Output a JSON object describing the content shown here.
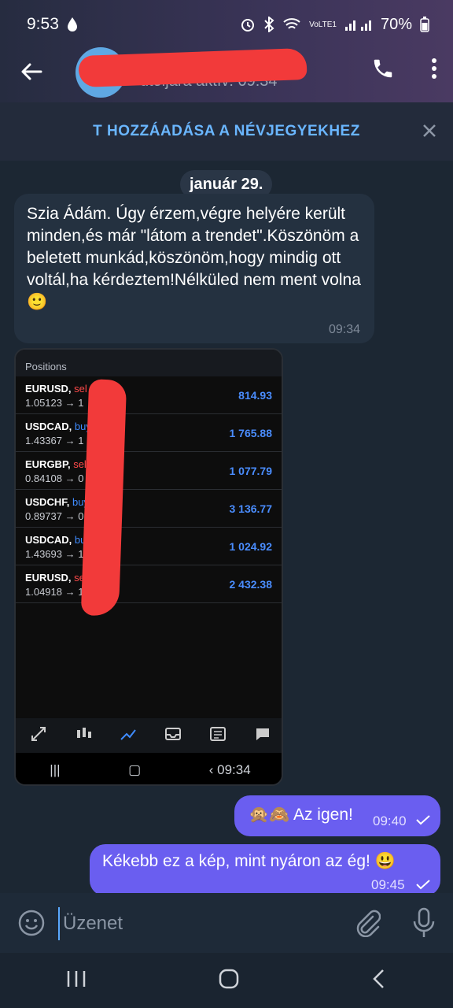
{
  "status_bar": {
    "time": "9:53",
    "battery": "70%",
    "network_label": "VoLTE1"
  },
  "header": {
    "contact_name": "",
    "last_seen": "utoljára aktív: 09:34"
  },
  "add_contact_banner": {
    "label": "T HOZZÁADÁSA A NÉVJEGYEKHEZ"
  },
  "chat": {
    "date_separator": "január 29.",
    "incoming_message": {
      "text": "Szia Ádám. Úgy érzem,végre helyére került minden,és már \"látom a trendet\".Köszönöm a beletett munkád,köszönöm,hogy mindig ott voltál,ha kérdeztem!Nélküled nem ment volna🙂",
      "time": "09:34"
    },
    "screenshot": {
      "header": "Positions",
      "positions": [
        {
          "symbol": "EURUSD,",
          "type": "sel",
          "type_class": "sell",
          "price": "1.05123 → 1",
          "profit": "814.93"
        },
        {
          "symbol": "USDCAD,",
          "type": "buy",
          "type_class": "buy",
          "price": "1.43367 → 1",
          "profit": "1 765.88"
        },
        {
          "symbol": "EURGBP,",
          "type": "sell",
          "type_class": "sell",
          "price": "0.84108 → 0",
          "profit": "1 077.79"
        },
        {
          "symbol": "USDCHF,",
          "type": "buy",
          "type_class": "buy",
          "price": "0.89737 → 0",
          "profit": "3 136.77"
        },
        {
          "symbol": "USDCAD,",
          "type": "buy",
          "type_class": "buy",
          "price": "1.43693 → 1.",
          "profit": "1 024.92"
        },
        {
          "symbol": "EURUSD,",
          "type": "sell",
          "type_class": "sell",
          "price": "1.04918 → 1",
          "profit": "2 432.38"
        }
      ],
      "nav_time": "09:34"
    },
    "outgoing_messages": [
      {
        "text": "🙊🙈 Az igen!",
        "time": "09:40"
      },
      {
        "text": "Kékebb ez a kép, mint nyáron az ég! 😃",
        "time": "09:45"
      }
    ]
  },
  "composer": {
    "placeholder": "Üzenet"
  },
  "colors": {
    "accent": "#6a5ef0",
    "link": "#6ab6ff",
    "background": "#1c2733"
  }
}
